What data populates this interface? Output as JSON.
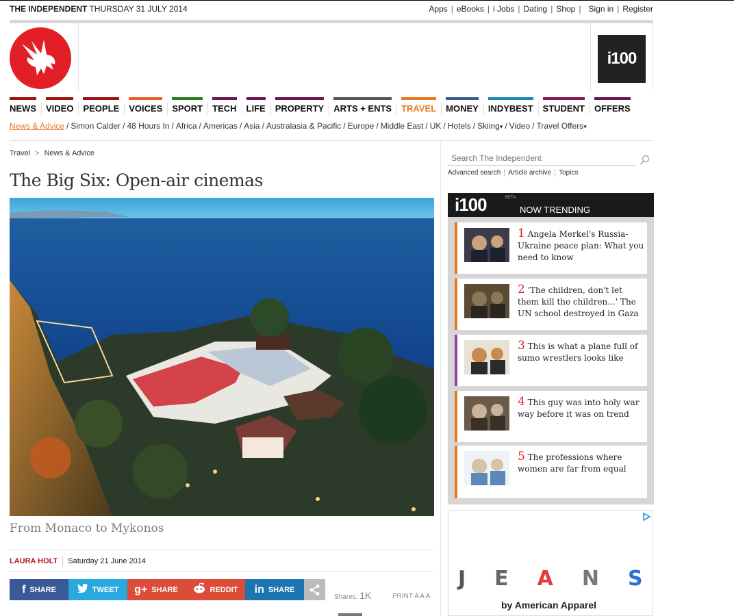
{
  "masthead": {
    "brand": "THE INDEPENDENT",
    "date": "THURSDAY 31 JULY 2014"
  },
  "toplinks": [
    "Apps",
    "eBooks",
    "i Jobs",
    "Dating",
    "Shop",
    "Sign in",
    "Register"
  ],
  "i100_badge": "i100",
  "nav": [
    {
      "label": "NEWS",
      "color": "#a10f14"
    },
    {
      "label": "VIDEO",
      "color": "#a10f14"
    },
    {
      "label": "PEOPLE",
      "color": "#a10f14"
    },
    {
      "label": "VOICES",
      "color": "#e8632a"
    },
    {
      "label": "SPORT",
      "color": "#2c7b1d"
    },
    {
      "label": "TECH",
      "color": "#6c1552"
    },
    {
      "label": "LIFE",
      "color": "#6c1552"
    },
    {
      "label": "PROPERTY",
      "color": "#6c1552"
    },
    {
      "label": "ARTS + ENTS",
      "color": "#555555"
    },
    {
      "label": "TRAVEL",
      "color": "#e87722",
      "active": true
    },
    {
      "label": "MONEY",
      "color": "#3b5b8f"
    },
    {
      "label": "INDYBEST",
      "color": "#1a8ab5"
    },
    {
      "label": "STUDENT",
      "color": "#8a1554"
    },
    {
      "label": "OFFERS",
      "color": "#6c1552"
    }
  ],
  "subnav": [
    "News & Advice",
    "Simon Calder",
    "48 Hours In",
    "Africa",
    "Americas",
    "Asia",
    "Australasia & Pacific",
    "Europe",
    "Middle East",
    "UK",
    "Hotels",
    "Skiing",
    "Video",
    "Travel Offers"
  ],
  "breadcrumb": [
    "Travel",
    "News & Advice"
  ],
  "article": {
    "headline": "The Big Six: Open-air cinemas",
    "subhead": "From Monaco to Mykonos",
    "author": "LAURA HOLT",
    "date": "Saturday 21 June 2014"
  },
  "share": [
    {
      "label": "SHARE",
      "icon": "f",
      "color": "#3b5998"
    },
    {
      "label": "TWEET",
      "icon": "t",
      "color": "#2aa9e0"
    },
    {
      "label": "SHARE",
      "icon": "g+",
      "color": "#dd4b39"
    },
    {
      "label": "REDDIT",
      "icon": "reddit",
      "color": "#dd4b39"
    },
    {
      "label": "SHARE",
      "icon": "in",
      "color": "#1c75b0"
    }
  ],
  "shares": {
    "label": "Shares:",
    "count": "1K"
  },
  "print": {
    "label": "PRINT",
    "sizes": "A A A"
  },
  "search": {
    "placeholder": "Search The Independent",
    "links": [
      "Advanced search",
      "Article archive",
      "Topics"
    ]
  },
  "trending": {
    "logo": "i100",
    "beta": "BETA",
    "title": "NOW TRENDING",
    "items": [
      {
        "num": "1",
        "text": "Angela Merkel's Russia-Ukraine peace plan: What you need to know",
        "accent": "#e87722"
      },
      {
        "num": "2",
        "text": "'The children, don't let them kill the children...' The UN school destroyed in Gaza",
        "accent": "#e87722"
      },
      {
        "num": "3",
        "text": "This is what a plane full of sumo wrestlers looks like",
        "accent": "#8e44ad"
      },
      {
        "num": "4",
        "text": "This guy was into holy war way before it was on trend",
        "accent": "#e87722"
      },
      {
        "num": "5",
        "text": "The professions where women are far from equal",
        "accent": "#e87722"
      }
    ]
  },
  "ad": {
    "letters": [
      "J",
      "E",
      "A",
      "N",
      "S"
    ],
    "by": "by American Apparel"
  }
}
